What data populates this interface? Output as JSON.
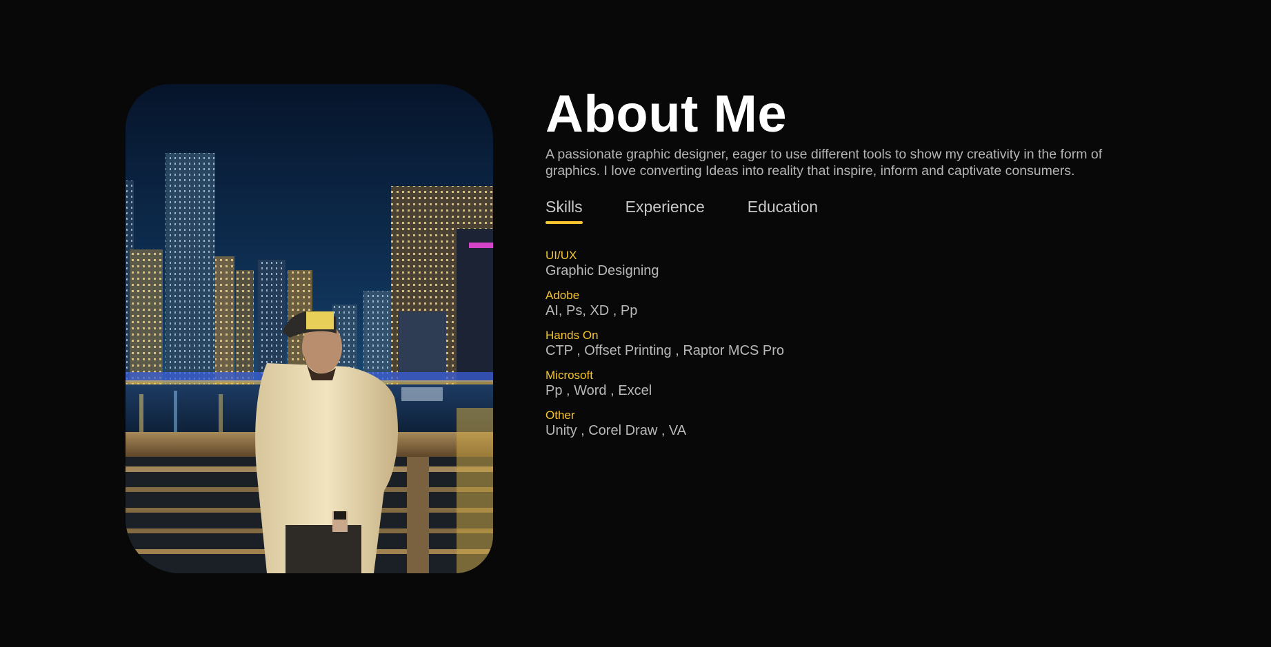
{
  "about": {
    "title": "About Me",
    "intro": "A passionate graphic designer, eager to use different tools to show my creativity in the form of graphics. I love converting Ideas into reality that inspire, inform and captivate consumers."
  },
  "tabs": [
    {
      "label": "Skills",
      "active": true
    },
    {
      "label": "Experience",
      "active": false
    },
    {
      "label": "Education",
      "active": false
    }
  ],
  "skills": [
    {
      "name": "UI/UX",
      "items": "Graphic Designing"
    },
    {
      "name": "Adobe",
      "items": "AI, Ps, XD , Pp"
    },
    {
      "name": "Hands On",
      "items": "CTP , Offset Printing , Raptor MCS Pro"
    },
    {
      "name": "Microsoft",
      "items": "Pp , Word , Excel"
    },
    {
      "name": "Other",
      "items": "Unity , Corel Draw , VA"
    }
  ],
  "colors": {
    "background": "#080808",
    "accent": "#f7c531",
    "title": "#ffffff",
    "text": "#b5b5b5"
  }
}
